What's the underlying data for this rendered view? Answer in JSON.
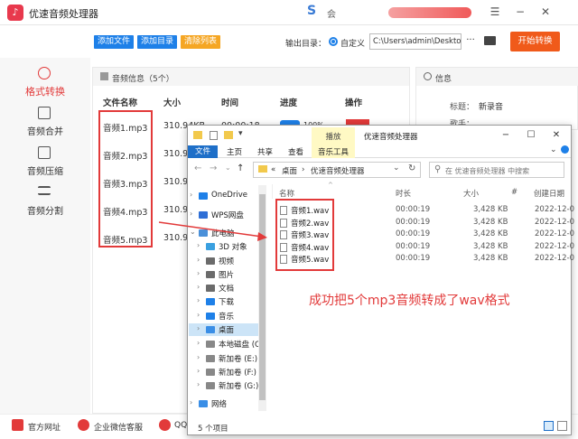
{
  "app": {
    "title": "优速音频处理器",
    "brand_glyph": "S",
    "user_glyph": "会"
  },
  "window_controls": {
    "menu": "☰",
    "minimize": "−",
    "close": "✕"
  },
  "toolbar": {
    "add_file": "添加文件",
    "add_folder": "添加目录",
    "clear_list": "清除列表",
    "output_label": "输出目录：",
    "output_mode": "自定义",
    "output_path": "C:\\Users\\admin\\Deskto",
    "more": "···",
    "start": "开始转换"
  },
  "sidebar": {
    "items": [
      {
        "label": "格式转换",
        "active": true
      },
      {
        "label": "音频合并"
      },
      {
        "label": "音频压缩"
      },
      {
        "label": "音频分割"
      }
    ]
  },
  "panel": {
    "title": "音频信息（5个）",
    "columns": [
      "文件名称",
      "大小",
      "时间",
      "进度",
      "操作"
    ],
    "rows": [
      {
        "name": "音频1.mp3",
        "size": "310.94KB",
        "time": "00:00:18",
        "progress": 100,
        "progress_label": "100%"
      },
      {
        "name": "音频2.mp3",
        "size": "310.94",
        "time": "",
        "progress": null
      },
      {
        "name": "音频3.mp3",
        "size": "310.94",
        "time": "",
        "progress": null
      },
      {
        "name": "音频4.mp3",
        "size": "310.94",
        "time": "",
        "progress": null
      },
      {
        "name": "音频5.mp3",
        "size": "310.94",
        "time": "",
        "progress": null
      }
    ]
  },
  "info": {
    "title": "信息",
    "title_label": "标题：",
    "title_value": "新录音",
    "artist_label": "歌手："
  },
  "bottom": {
    "website": "官方网址",
    "support": "企业微信客服",
    "qq": "QQ"
  },
  "explorer": {
    "window_title": "优速音频处理器",
    "context_tab": "播放",
    "tabs": [
      "文件",
      "主页",
      "共享",
      "查看",
      "音乐工具"
    ],
    "address": [
      "«",
      "桌面",
      "›",
      "优速音频处理器"
    ],
    "search_placeholder": "在 优速音频处理器 中搜索",
    "nav": [
      {
        "label": "OneDrive",
        "color": "#1e80e8"
      },
      {
        "label": "WPS网盘",
        "color": "#2f6fd6"
      },
      {
        "label": "此电脑",
        "color": "#4a90d9"
      },
      {
        "label": "3D 对象",
        "color": "#3aa0e0"
      },
      {
        "label": "视频",
        "color": "#6b6b6b"
      },
      {
        "label": "图片",
        "color": "#6b6b6b"
      },
      {
        "label": "文档",
        "color": "#6b6b6b"
      },
      {
        "label": "下载",
        "color": "#1e80e8"
      },
      {
        "label": "音乐",
        "color": "#1e80e8"
      },
      {
        "label": "桌面",
        "color": "#3a8ee6"
      },
      {
        "label": "本地磁盘 (C:)",
        "color": "#888888"
      },
      {
        "label": "新加卷 (E:)",
        "color": "#888888"
      },
      {
        "label": "新加卷 (F:)",
        "color": "#888888"
      },
      {
        "label": "新加卷 (G:)",
        "color": "#888888"
      },
      {
        "label": "网络",
        "color": "#3a8ee6"
      }
    ],
    "columns": [
      "名称",
      "时长",
      "大小",
      "#",
      "创建日期"
    ],
    "files": [
      {
        "name": "音频1.wav",
        "duration": "00:00:19",
        "size": "3,428 KB",
        "created": "2022-12-0"
      },
      {
        "name": "音频2.wav",
        "duration": "00:00:19",
        "size": "3,428 KB",
        "created": "2022-12-0"
      },
      {
        "name": "音频3.wav",
        "duration": "00:00:19",
        "size": "3,428 KB",
        "created": "2022-12-0"
      },
      {
        "name": "音频4.wav",
        "duration": "00:00:19",
        "size": "3,428 KB",
        "created": "2022-12-0"
      },
      {
        "name": "音频5.wav",
        "duration": "00:00:19",
        "size": "3,428 KB",
        "created": "2022-12-0"
      }
    ],
    "status": "5 个项目"
  },
  "caption": "成功把5个mp3音频转成了wav格式",
  "colors": {
    "accent": "#1e80e8",
    "start": "#f05a1a",
    "red": "#e23a3a",
    "clear": "#f5a623"
  }
}
